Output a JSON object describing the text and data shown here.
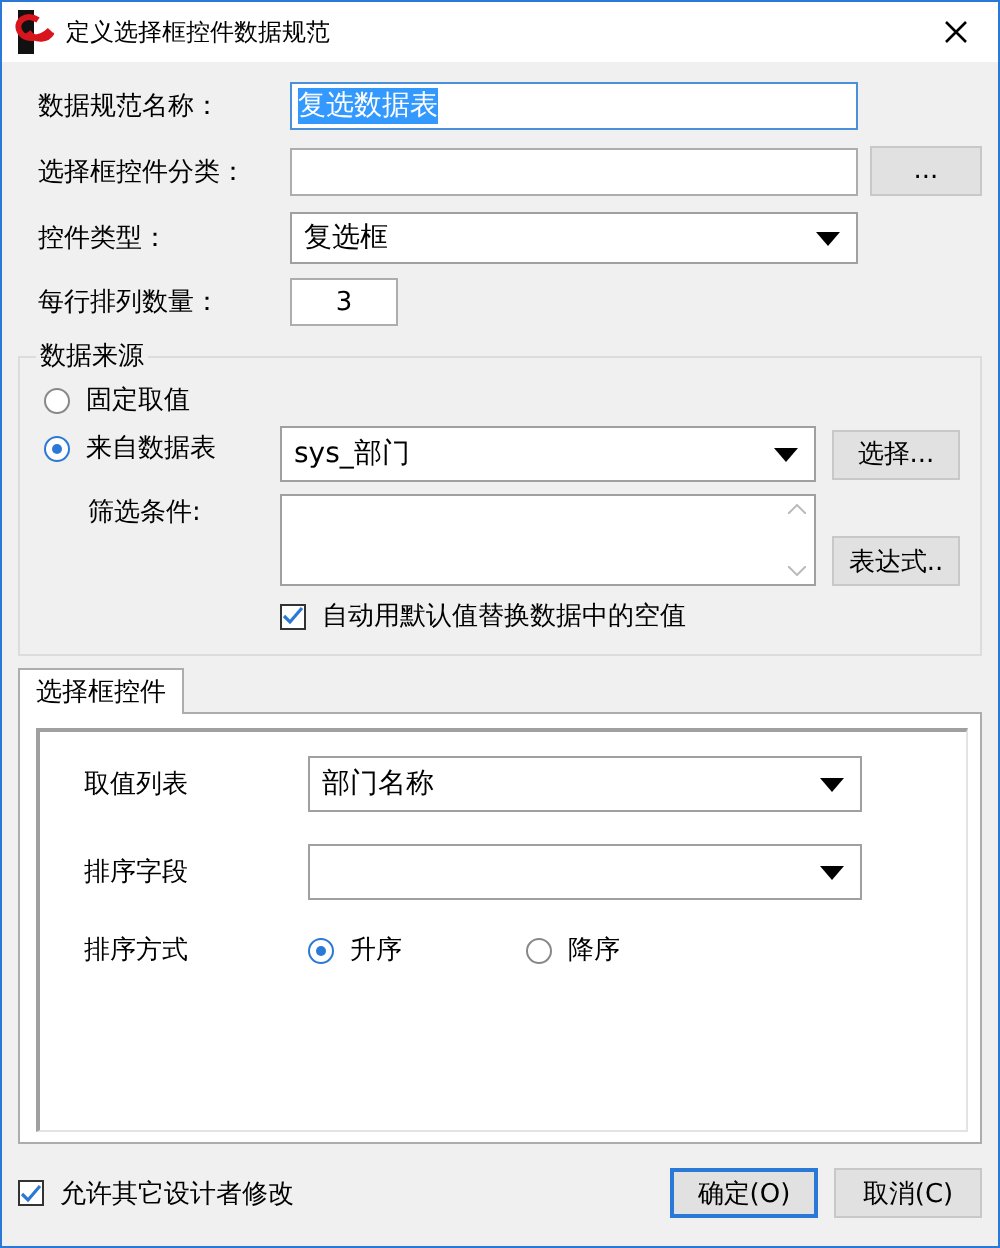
{
  "window": {
    "title": "定义选择框控件数据规范"
  },
  "name_field": {
    "label": "数据规范名称：",
    "value": "复选数据表",
    "text_selected": true
  },
  "category_field": {
    "label": "选择框控件分类：",
    "button": "..."
  },
  "type_field": {
    "label": "控件类型：",
    "value": "复选框"
  },
  "per_row_field": {
    "label": "每行排列数量：",
    "value": "3"
  },
  "data_source": {
    "title": "数据来源",
    "options": [
      {
        "label": "固定取值",
        "selected": false
      },
      {
        "label": "来自数据表",
        "selected": true
      }
    ],
    "table_select": {
      "value": "sys_部门"
    },
    "select_button": "选择...",
    "filter": {
      "label": "筛选条件:"
    },
    "expression_button": "表达式..",
    "replace_empty": {
      "label": "自动用默认值替换数据中的空值",
      "checked": true
    }
  },
  "tabs": [
    {
      "label": "选择框控件",
      "selected": true
    }
  ],
  "tab_panel": {
    "value_list": {
      "label": "取值列表",
      "value": "部门名称"
    },
    "sort_field": {
      "label": "排序字段"
    },
    "sort_order": {
      "label": "排序方式",
      "options": [
        {
          "label": "升序",
          "selected": true
        },
        {
          "label": "降序",
          "selected": false
        }
      ]
    }
  },
  "allow_modify": {
    "label": "允许其它设计者修改",
    "checked": true
  },
  "buttons": [
    {
      "label": "确定(O)",
      "default": true
    },
    {
      "label": "取消(C)",
      "default": false
    }
  ]
}
